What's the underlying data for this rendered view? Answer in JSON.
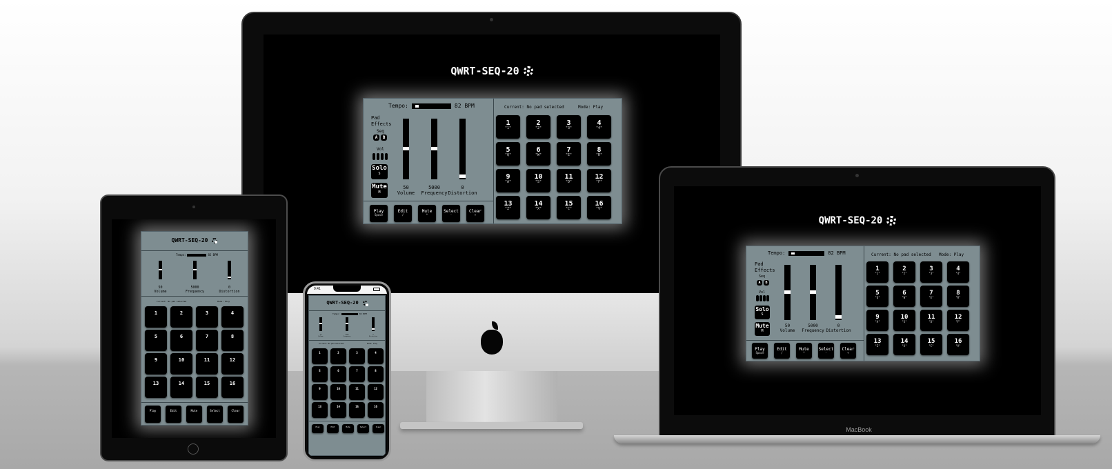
{
  "app": {
    "title": "QWRT-SEQ-20",
    "tempo_label": "Tempo:",
    "tempo_value": "82 BPM",
    "tempo_fraction": 0.08,
    "current": "Current: No pad selected",
    "mode": "Mode: Play",
    "pad_effects": [
      "Pad",
      "Effects"
    ],
    "seq_label": "Seq",
    "seq_buttons": [
      "A",
      "B"
    ],
    "vol_label": "Vol",
    "solo": {
      "label": "Solo",
      "key": "S"
    },
    "mute": {
      "label": "Mute",
      "key": "M"
    },
    "sliders": [
      {
        "value": "50",
        "label": "Volume",
        "level": 0.5
      },
      {
        "value": "5000",
        "label": "Frequency",
        "level": 0.5
      },
      {
        "value": "0",
        "label": "Distortion",
        "level": 0.0
      }
    ],
    "controls": [
      {
        "label": "Play",
        "key": "Space"
      },
      {
        "label": "Edit",
        "key": "/"
      },
      {
        "label": "Mute",
        "key": "*"
      },
      {
        "label": "Select",
        "key": "-"
      },
      {
        "label": "Clear",
        "key": "+"
      }
    ],
    "pads": [
      {
        "n": "1",
        "k": "\"1\""
      },
      {
        "n": "2",
        "k": "\"2\""
      },
      {
        "n": "3",
        "k": "\"3\""
      },
      {
        "n": "4",
        "k": "\"4\""
      },
      {
        "n": "5",
        "k": "\"Q\""
      },
      {
        "n": "6",
        "k": "\"W\""
      },
      {
        "n": "7",
        "k": "\"E\""
      },
      {
        "n": "8",
        "k": "\"R\""
      },
      {
        "n": "9",
        "k": "\"A\""
      },
      {
        "n": "10",
        "k": "\"S\""
      },
      {
        "n": "11",
        "k": "\"D\""
      },
      {
        "n": "12",
        "k": "\"F\""
      },
      {
        "n": "13",
        "k": "\"Z\""
      },
      {
        "n": "14",
        "k": "\"X\""
      },
      {
        "n": "15",
        "k": "\"C\""
      },
      {
        "n": "16",
        "k": "\"V\""
      }
    ]
  },
  "devices": {
    "laptop_brand": "MacBook",
    "phone_time": "9:41"
  },
  "colors": {
    "panel": "#7e8d91",
    "pad": "#000000",
    "screen": "#000000"
  }
}
